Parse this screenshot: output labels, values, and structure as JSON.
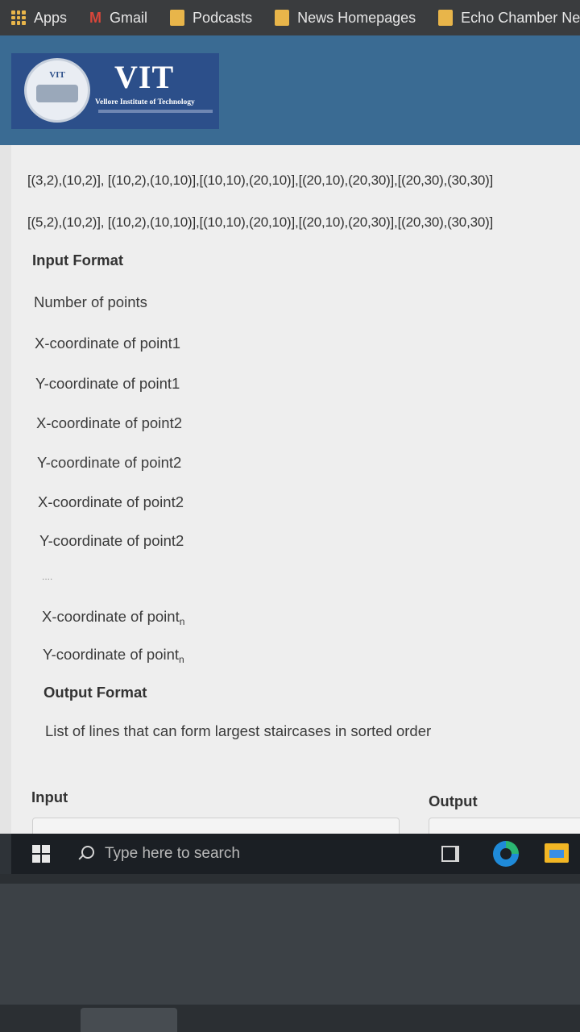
{
  "bookmarks": [
    {
      "label": "Apps",
      "icon": "apps-grid-icon"
    },
    {
      "label": "Gmail",
      "icon": "gmail-icon"
    },
    {
      "label": "Podcasts",
      "icon": "folder-icon"
    },
    {
      "label": "News Homepages",
      "icon": "folder-icon"
    },
    {
      "label": "Echo Chamber New",
      "icon": "folder-icon"
    }
  ],
  "header": {
    "seal_text": "VIT",
    "logo_title": "VIT",
    "logo_subtitle": "Vellore Institute of Technology",
    "brand_color": "#2c4f8a"
  },
  "content": {
    "example_line_1": "[(3,2),(10,2)], [(10,2),(10,10)],[(10,10),(20,10)],[(20,10),(20,30)],[(20,30),(30,30)]",
    "example_line_2": "[(5,2),(10,2)], [(10,2),(10,10)],[(10,10),(20,10)],[(20,10),(20,30)],[(20,30),(30,30)]",
    "input_format_heading": "Input Format",
    "input_lines": [
      "Number of points",
      "X-coordinate of point1",
      "Y-coordinate of point1",
      "X-coordinate of point2",
      "Y-coordinate of point2",
      "X-coordinate of point2",
      "Y-coordinate of point2"
    ],
    "ellipsis": "....",
    "x_point_n": "X-coordinate of point",
    "y_point_n": "Y-coordinate of point",
    "subscript_n": "n",
    "output_format_heading": "Output Format",
    "output_description": "List of lines that can form largest staircases in sorted order",
    "input_label": "Input",
    "output_label": "Output"
  },
  "taskbar": {
    "search_placeholder": "Type here to search"
  }
}
